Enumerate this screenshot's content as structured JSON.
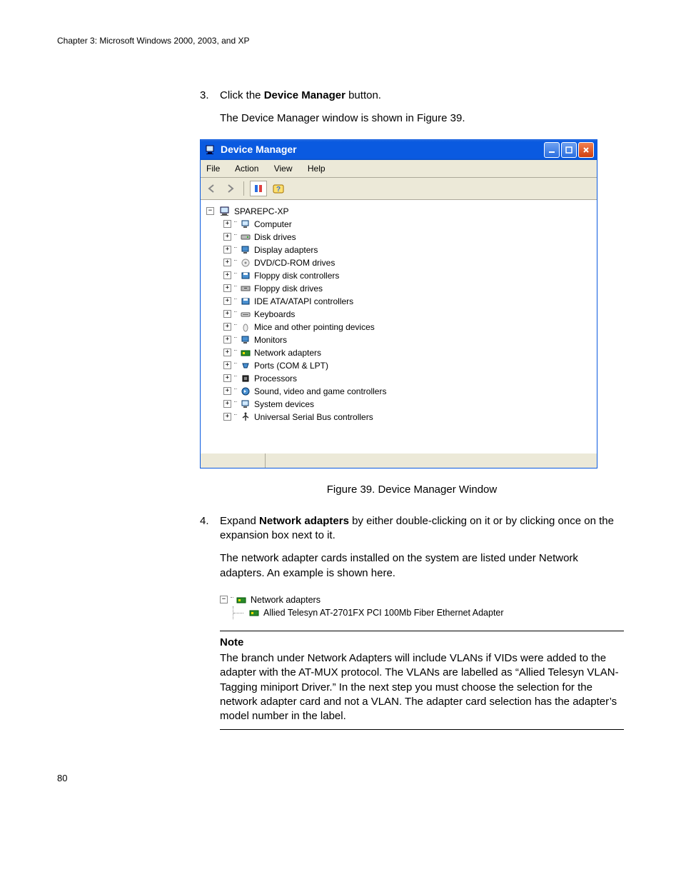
{
  "chapter_header": "Chapter 3: Microsoft Windows 2000, 2003, and XP",
  "step3": {
    "num": "3.",
    "text_before": "Click the ",
    "bold": "Device Manager",
    "text_after": " button.",
    "para": "The Device Manager window is shown in Figure 39."
  },
  "devmgr": {
    "title": "Device Manager",
    "menu": {
      "file": "File",
      "action": "Action",
      "view": "View",
      "help": "Help"
    },
    "root": "SPAREPC-XP",
    "nodes": [
      "Computer",
      "Disk drives",
      "Display adapters",
      "DVD/CD-ROM drives",
      "Floppy disk controllers",
      "Floppy disk drives",
      "IDE ATA/ATAPI controllers",
      "Keyboards",
      "Mice and other pointing devices",
      "Monitors",
      "Network adapters",
      "Ports (COM & LPT)",
      "Processors",
      "Sound, video and game controllers",
      "System devices",
      "Universal Serial Bus controllers"
    ]
  },
  "figure_caption": "Figure 39. Device Manager Window",
  "step4": {
    "num": "4.",
    "text_before": "Expand ",
    "bold": "Network adapters",
    "text_after": " by either double-clicking on it or by clicking once on the expansion box next to it.",
    "para": "The network adapter cards installed on the system are listed under Network adapters. An example is shown here."
  },
  "net_expand": {
    "parent": "Network adapters",
    "child": "Allied Telesyn AT-2701FX PCI 100Mb Fiber Ethernet Adapter"
  },
  "note": {
    "title": "Note",
    "body": "The branch under Network Adapters will include VLANs if VIDs were added to the adapter with the AT-MUX protocol. The VLANs are labelled as “Allied Telesyn VLAN-Tagging miniport Driver.” In the next step you must choose the selection for the network adapter card and not a VLAN. The adapter card selection has the adapter’s model number in the label."
  },
  "page_number": "80"
}
